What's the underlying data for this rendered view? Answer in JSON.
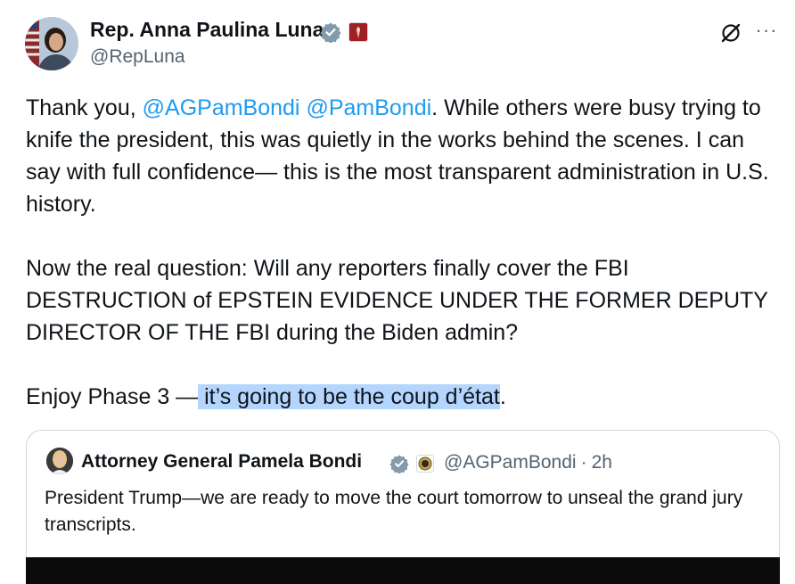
{
  "author": {
    "name": "Rep. Anna Paulina Luna",
    "handle": "@RepLuna"
  },
  "tweet": {
    "para1_before": "Thank you, ",
    "mention1": "@AGPamBondi",
    "space": " ",
    "mention2": "@PamBondi",
    "para1_after": ". While others were busy trying to knife the president, this was quietly in the works behind the scenes. I can say with full confidence— this is the most transparent administration in U.S. history.",
    "para2": "Now the real question: Will any reporters finally cover the FBI DESTRUCTION of EPSTEIN EVIDENCE UNDER THE FORMER DEPUTY DIRECTOR OF THE FBI during the Biden admin?",
    "para3_before": "Enjoy Phase 3 —",
    "para3_selected": " it’s going to be the coup d’état",
    "para3_after": "."
  },
  "quoted": {
    "name": "Attorney General Pamela Bondi",
    "handle": "@AGPamBondi",
    "dot": "·",
    "time": "2h",
    "text": "President Trump—we are ready to move the court tomorrow to unseal the grand jury transcripts."
  },
  "icons": {
    "verified": "verified-badge-icon",
    "affiliate": "affiliate-badge-icon",
    "grok": "grok-icon",
    "more": "more-icon"
  },
  "colors": {
    "link": "#1d9bf0",
    "selection": "#b4d5fe",
    "secondary_text": "#536471",
    "verified_gray": "#829aab"
  }
}
